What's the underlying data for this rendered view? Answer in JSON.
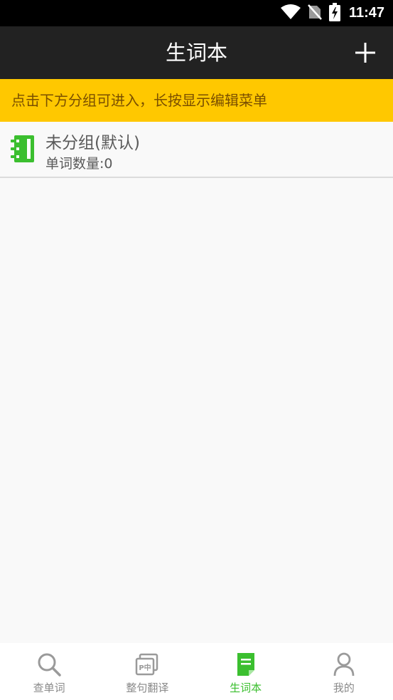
{
  "status_bar": {
    "time": "11:47",
    "icons": [
      "wifi-icon",
      "no-sim-icon",
      "battery-charging-icon"
    ]
  },
  "app_bar": {
    "title": "生词本",
    "action_icon": "plus-icon"
  },
  "hint_banner": {
    "text": "点击下方分组可进入，长按显示编辑菜单"
  },
  "groups": [
    {
      "name": "未分组(默认)",
      "word_count": "单词数量:0",
      "icon": "notebook-icon"
    }
  ],
  "bottom_nav": {
    "items": [
      {
        "label": "查单词",
        "icon": "search-icon",
        "active": false
      },
      {
        "label": "整句翻译",
        "icon": "translate-icon",
        "active": false
      },
      {
        "label": "生词本",
        "icon": "vocabulary-book-icon",
        "active": true
      },
      {
        "label": "我的",
        "icon": "user-icon",
        "active": false
      }
    ]
  },
  "colors": {
    "accent": "#3bbf2f",
    "banner": "#ffc800",
    "app_bar": "#222222",
    "nav_inactive": "#8a8a8a"
  }
}
